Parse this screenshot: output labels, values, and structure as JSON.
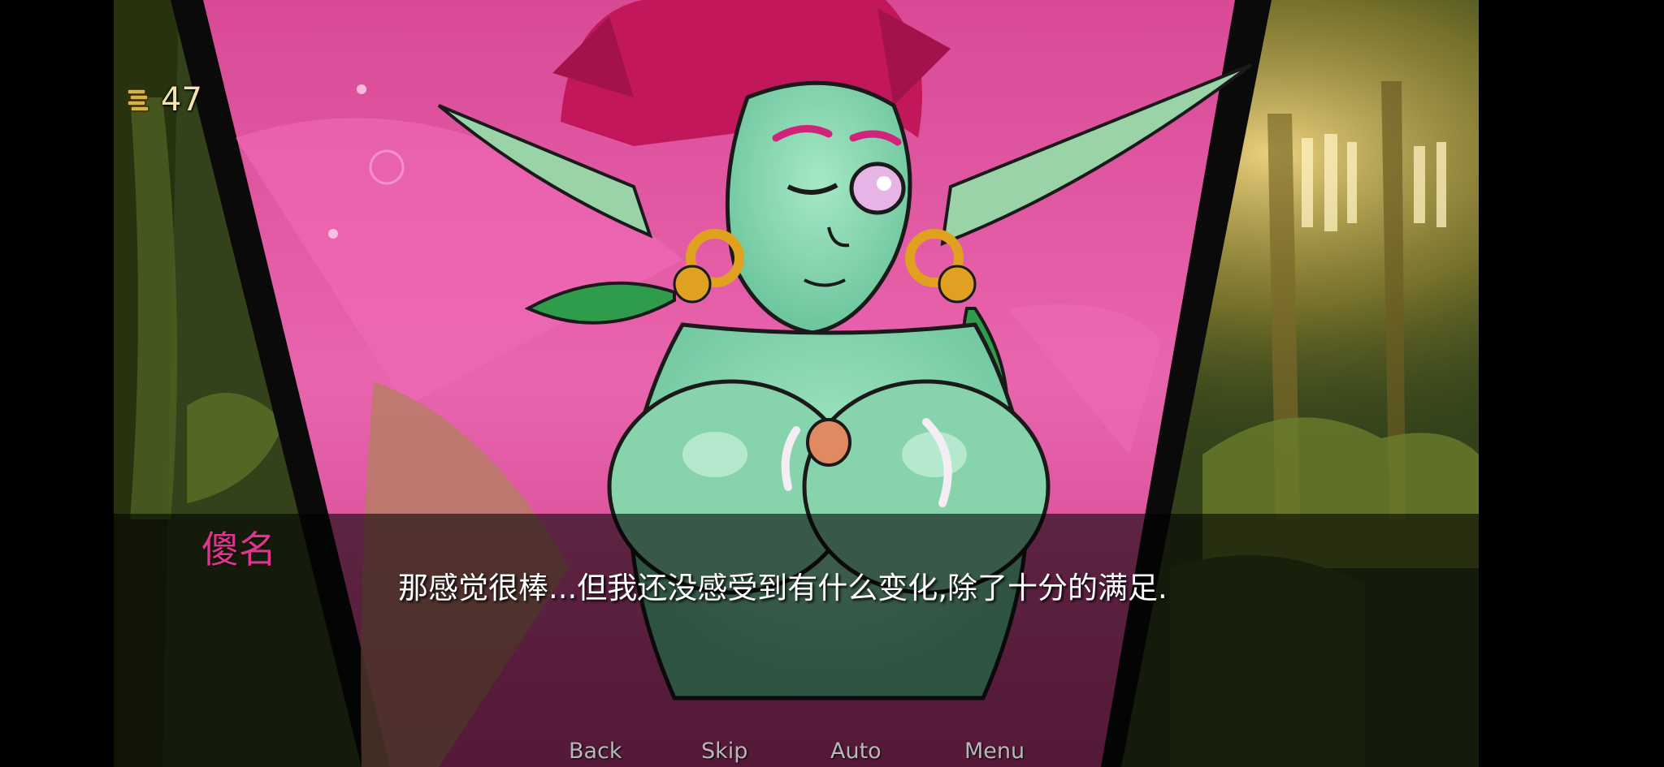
{
  "hud": {
    "currency_amount": "47",
    "currency_icon": "coin-stack-icon"
  },
  "dialogue": {
    "speaker": "傻名",
    "text": "那感觉很棒...但我还没感受到有什么变化,除了十分的满足."
  },
  "quick_menu": {
    "back": "Back",
    "skip": "Skip",
    "auto": "Auto",
    "menu": "Menu"
  },
  "colors": {
    "speaker_name": "#e0358f",
    "dialogue_text": "#ffffff",
    "quick_menu_text": "#b8b8b8",
    "currency_text": "#f2e4b0",
    "skin": "#8fd9b5",
    "hair": "#c2185b",
    "background_pink": "#e84ea3",
    "forest_green": "#4a5a22"
  }
}
